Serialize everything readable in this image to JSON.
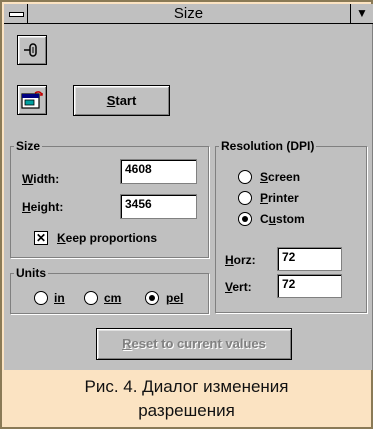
{
  "window": {
    "title": "Size",
    "menu_icon": "system-menu-icon",
    "dropdown_icon": "dropdown-arrow-icon"
  },
  "toolbar": {
    "start_label_u": "S",
    "start_label_rest": "tart",
    "tool_icon": "resize-tool-icon",
    "preview_icon": "window-preview-icon"
  },
  "size": {
    "legend": "Size",
    "width_label_u": "W",
    "width_label_rest": "idth:",
    "width_value": "4608",
    "height_label_u": "H",
    "height_label_rest": "eight:",
    "height_value": "3456",
    "keep_u": "K",
    "keep_rest": "eep proportions",
    "keep_checked": true
  },
  "units": {
    "legend": "Units",
    "in": "in",
    "cm": "cm",
    "pel": "pel",
    "selected": "pel"
  },
  "resolution": {
    "legend": "Resolution (DPI)",
    "screen_u": "S",
    "screen_rest": "creen",
    "printer_u": "P",
    "printer_rest": "rinter",
    "custom_pre": "C",
    "custom_u": "u",
    "custom_rest": "stom",
    "selected": "custom",
    "horz_u": "H",
    "horz_rest": "orz:",
    "horz_value": "72",
    "vert_u": "V",
    "vert_rest": "ert:",
    "vert_value": "72"
  },
  "reset": {
    "u": "R",
    "rest": "eset to current values"
  },
  "caption": {
    "line1": "Рис. 4. Диалог изменения",
    "line2": "разрешения"
  }
}
